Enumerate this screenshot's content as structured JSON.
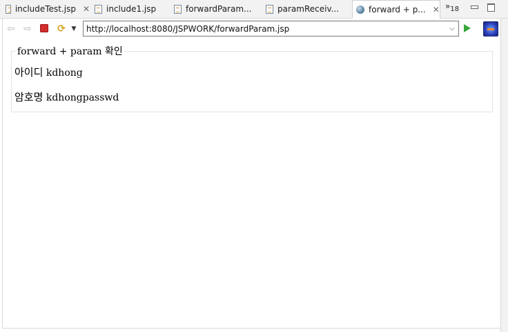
{
  "tabs": [
    {
      "label": "includeTest.jsp",
      "icon": "jsp-file-icon",
      "active": false,
      "closable": true
    },
    {
      "label": "include1.jsp",
      "icon": "jsp-file-icon",
      "active": false,
      "closable": false
    },
    {
      "label": "forwardParam...",
      "icon": "jsp-file-icon",
      "active": false,
      "closable": false
    },
    {
      "label": "paramReceiv...",
      "icon": "jsp-file-icon",
      "active": false,
      "closable": false
    },
    {
      "label": "forward + p...",
      "icon": "globe-icon",
      "active": true,
      "closable": true
    }
  ],
  "overflow": {
    "chevron": "»",
    "count": "18"
  },
  "toolbar": {
    "url": "http://localhost:8080/JSPWORK/forwardParam.jsp",
    "icons": [
      "back-arrow-icon",
      "forward-arrow-icon",
      "stop-icon",
      "refresh-icon",
      "dropdown-caret-icon",
      "go-icon",
      "navigate-icon"
    ]
  },
  "page": {
    "legend": "forward + param 확인",
    "fields": [
      {
        "key": "아이디",
        "value": "kdhong"
      },
      {
        "key": "암호명",
        "value": "kdhongpasswd"
      }
    ]
  },
  "colors": {
    "stop": "#d12d2d",
    "go": "#3aa63a",
    "tab_bg": "#f2f2f2"
  }
}
